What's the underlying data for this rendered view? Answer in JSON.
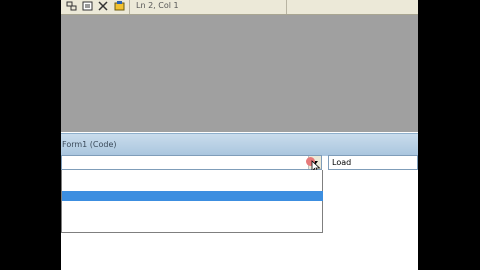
{
  "toolbar": {
    "icons": [
      "project-explorer-icon",
      "properties-window-icon",
      "toolbox-icon",
      "object-browser-icon"
    ],
    "cursor_position": "Ln 2, Col 1"
  },
  "code_window": {
    "title": "Form1 (Code)",
    "object_combo_value": "",
    "procedure_combo_value": "Load",
    "dropdown_items": [
      "",
      "",
      ""
    ],
    "selected_index": 1
  },
  "colors": {
    "mdi_background": "#a0a0a0",
    "selection": "#3c8ee0",
    "title_bar": "#a9c5de"
  }
}
